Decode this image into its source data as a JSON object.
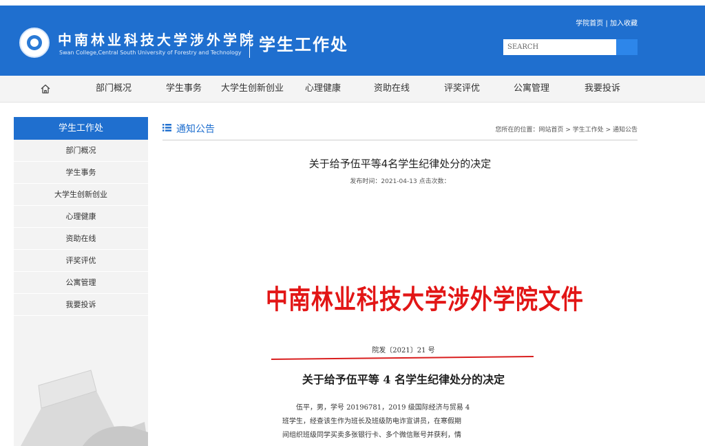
{
  "header": {
    "school_name_cn": "中南林业科技大学涉外学院",
    "school_name_en": "Swan College,Central South University of Forestry and Technology",
    "dept_title": "学生工作处",
    "top_links": [
      "学院首页",
      "加入收藏"
    ],
    "top_links_sep": "|",
    "search_placeholder": "SEARCH"
  },
  "nav": {
    "home_icon": "home-icon",
    "items": [
      "部门概况",
      "学生事务",
      "大学生创新创业",
      "心理健康",
      "资助在线",
      "评奖评优",
      "公寓管理",
      "我要投诉"
    ]
  },
  "sidebar": {
    "title": "学生工作处",
    "items": [
      "部门概况",
      "学生事务",
      "大学生创新创业",
      "心理健康",
      "资助在线",
      "评奖评优",
      "公寓管理",
      "我要投诉"
    ]
  },
  "section": {
    "title": "通知公告",
    "breadcrumb": "您所在的位置：网站首页 > 学生工作处 > 通知公告"
  },
  "article": {
    "title": "关于给予伍平等4名学生纪律处分的决定",
    "meta": "发布时间：2021-04-13   点击次数：",
    "doc_header": "中南林业科技大学涉外学院文件",
    "doc_number": "院发〔2021〕21 号",
    "doc_subtitle": "关于给予伍平等 4 名学生纪律处分的决定",
    "doc_lines": [
      "伍平，男，学号 20196781，2019 级国际经济与贸易 4",
      "班学生，经查该生作为班长及班级防电诈宣讲员，在寒假期",
      "间组织班级同学买卖多张银行卡、多个微信账号并获利，情"
    ]
  },
  "colors": {
    "primary": "#1f6fcf",
    "doc_red": "#e21616"
  }
}
